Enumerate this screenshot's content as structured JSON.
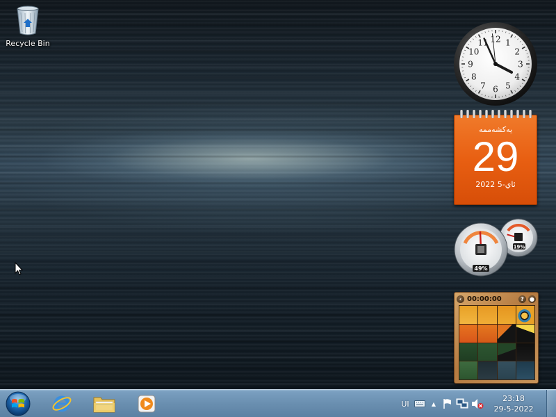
{
  "desktop": {
    "icons": [
      {
        "label": "Recycle Bin",
        "icon": "recycle-bin-icon"
      }
    ]
  },
  "gadgets": {
    "clock": {
      "hour": 3,
      "minute": 55,
      "second": 59,
      "numerals": [
        "12",
        "1",
        "2",
        "3",
        "4",
        "5",
        "6",
        "7",
        "8",
        "9",
        "10",
        "11"
      ]
    },
    "calendar": {
      "weekday": "یەکشەممە",
      "day": "29",
      "month_year": "ئاي-5 2022",
      "color": "#e8620f"
    },
    "cpu_meter": {
      "cpu_percent": "49%",
      "memory_percent": "19%",
      "cpu_level": 0.49,
      "memory_level": 0.19
    },
    "picture_puzzle": {
      "timer": "00:00:00",
      "back_icon": "back-arrow-icon",
      "help_icon": "help-icon",
      "hint_icon": "picture-hint-icon"
    }
  },
  "taskbar": {
    "start": {
      "icon": "windows-logo-icon"
    },
    "pinned": [
      {
        "name": "Internet Explorer",
        "icon": "internet-explorer-icon"
      },
      {
        "name": "Windows Explorer",
        "icon": "folder-icon"
      },
      {
        "name": "Windows Media Player",
        "icon": "media-player-icon"
      }
    ],
    "tray": {
      "language": "UI",
      "icons": [
        "keyboard-icon",
        "show-hidden-icons-arrow",
        "action-center-flag-icon",
        "network-icon",
        "volume-muted-icon"
      ],
      "time": "23:18",
      "date": "29-5-2022"
    },
    "accent": "#6a8fb0"
  }
}
